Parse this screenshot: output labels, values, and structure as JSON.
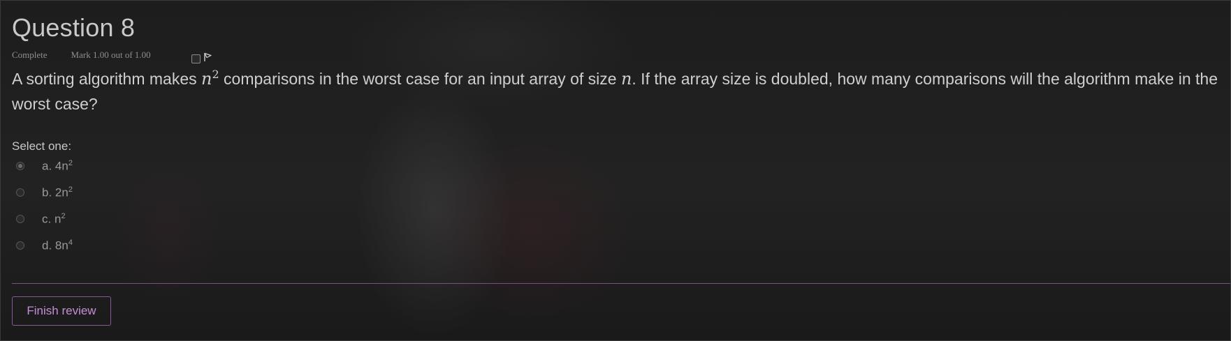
{
  "question": {
    "title": "Question 8",
    "state": "Complete",
    "grade": "Mark 1.00 out of 1.00",
    "flag_icon": "flag-icon",
    "text": {
      "p1": "A sorting algorithm makes ",
      "m1_base": "n",
      "m1_exp": "2",
      "p2": " comparisons in the worst case for an input array of size ",
      "m2": "n",
      "p3": ". If the array size is doubled, how many comparisons will the algorithm make in the worst case?"
    },
    "prompt": "Select one:",
    "options": [
      {
        "letter": "a.",
        "base": "4n",
        "exp": "2",
        "selected": true
      },
      {
        "letter": "b.",
        "base": "2n",
        "exp": "2",
        "selected": false
      },
      {
        "letter": "c.",
        "base": "n",
        "exp": "2",
        "selected": false
      },
      {
        "letter": "d.",
        "base": "8n",
        "exp": "4",
        "selected": false
      }
    ]
  },
  "footer": {
    "finish_label": "Finish review"
  },
  "colors": {
    "accent": "#c48fd6",
    "divider": "#7a4f86"
  }
}
